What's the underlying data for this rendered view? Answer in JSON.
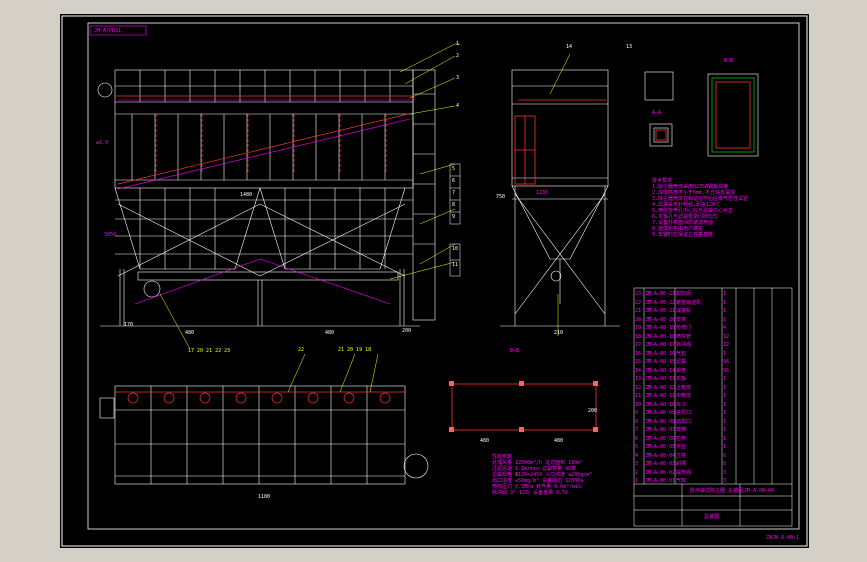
{
  "sheet": {
    "drawing_code": "JM-A/PDJ1",
    "footer_code": "ZWJN-A-00-1"
  },
  "section_views": {
    "side_section_label": "A—A",
    "plan_label": "B—B",
    "box_left_label": "A—A",
    "box_right_label": "B—B"
  },
  "front_dims": {
    "overall_width": "1480",
    "half_width": "1480",
    "left_bay": "480",
    "right_bay": "480",
    "left_offset": "170",
    "right_offset": "200",
    "height": "3050",
    "top_level": "±0.0"
  },
  "side_dims": {
    "depth": "1230",
    "height": "750",
    "base": "210"
  },
  "top_dims": {
    "overall_length": "1180"
  },
  "footprint_dims": {
    "left": "480",
    "right": "480",
    "height": "200"
  },
  "leader_numbers": [
    "1",
    "2",
    "3",
    "4",
    "5",
    "6",
    "7",
    "8",
    "9",
    "10",
    "11",
    "12",
    "13",
    "14"
  ],
  "bottom_callouts": [
    "17 20 21 22 23"
  ],
  "top_callouts": [
    "22",
    "21 20 19 18"
  ],
  "notes_title": "技术要求",
  "notes": [
    "1.除尘器壳体采用Q235A钢板焊接",
    "2.焊缝高度不小于6mm,不允许有漏焊",
    "3.除尘器壳体在制造完毕后应做气密性试验",
    "4.滤袋采用针刺毡,耐温120℃",
    "5.喷吹管喷孔中心应与滤袋中心对正",
    "6.花板孔与滤袋框架间隙均匀",
    "7.设备外表面涂防锈漆两遍",
    "8.面漆颜色由用户确定",
    "9.安装时应保证立柱垂直度"
  ],
  "spec_title": "性能参数",
  "spec_rows": [
    [
      "处理风量",
      "12000m³/h",
      "过滤面积",
      "180m²"
    ],
    [
      "过滤风速",
      "1.1m/min",
      "滤袋数量",
      "96条"
    ],
    [
      "滤袋规格",
      "Φ130×2450",
      "入口浓度",
      "≤200g/m³"
    ],
    [
      "出口浓度",
      "≤50mg/m³",
      "设备阻力",
      "1200Pa"
    ],
    [
      "喷吹压力",
      "0.5MPa",
      "耗气量",
      "0.6m³/min"
    ],
    [
      "脉冲阀",
      "3\" 12只",
      "设备重量",
      "8.5t"
    ]
  ],
  "bom_rows": [
    [
      "23",
      "JM-A-00-23",
      "卸灰阀",
      "1",
      "",
      ""
    ],
    [
      "22",
      "JM-A-00-22",
      "螺旋输送机",
      "1",
      "",
      ""
    ],
    [
      "21",
      "JM-A-00-21",
      "减速机",
      "1",
      "",
      ""
    ],
    [
      "20",
      "JM-A-00-20",
      "支架",
      "1",
      "",
      ""
    ],
    [
      "19",
      "JM-A-00-19",
      "检修门",
      "4",
      "",
      ""
    ],
    [
      "18",
      "JM-A-00-18",
      "喷吹管",
      "12",
      "",
      ""
    ],
    [
      "17",
      "JM-A-00-17",
      "脉冲阀",
      "12",
      "",
      ""
    ],
    [
      "16",
      "JM-A-00-16",
      "气包",
      "1",
      "",
      ""
    ],
    [
      "15",
      "JM-A-00-15",
      "滤袋",
      "96",
      "",
      ""
    ],
    [
      "14",
      "JM-A-00-14",
      "袋笼",
      "96",
      "",
      ""
    ],
    [
      "13",
      "JM-A-00-13",
      "花板",
      "1",
      "",
      ""
    ],
    [
      "12",
      "JM-A-00-12",
      "上箱体",
      "1",
      "",
      ""
    ],
    [
      "11",
      "JM-A-00-11",
      "中箱体",
      "1",
      "",
      ""
    ],
    [
      "10",
      "JM-A-00-10",
      "灰斗",
      "1",
      "",
      ""
    ],
    [
      "9",
      "JM-A-00-09",
      "进风口",
      "1",
      "",
      ""
    ],
    [
      "8",
      "JM-A-00-08",
      "出风口",
      "1",
      "",
      ""
    ],
    [
      "7",
      "JM-A-00-07",
      "爬梯",
      "1",
      "",
      ""
    ],
    [
      "6",
      "JM-A-00-06",
      "栏杆",
      "1",
      "",
      ""
    ],
    [
      "5",
      "JM-A-00-05",
      "平台",
      "1",
      "",
      ""
    ],
    [
      "4",
      "JM-A-00-04",
      "立柱",
      "6",
      "",
      ""
    ],
    [
      "3",
      "JM-A-00-03",
      "斜撑",
      "8",
      "",
      ""
    ],
    [
      "2",
      "JM-A-00-02",
      "提升阀",
      "3",
      "",
      ""
    ],
    [
      "1",
      "JM-A-00-01",
      "气缸",
      "3",
      "",
      ""
    ]
  ],
  "title_block": {
    "title": "脉冲袋式除尘器 总装图",
    "drawing_no": "JM-A-00-00",
    "sheet_label": "总装图"
  },
  "colors": {
    "outline": "#ffffff",
    "annotation": "#ff00ff",
    "leader": "#ffff00",
    "hidden": "#ff3030",
    "highlight": "#00ff00"
  }
}
